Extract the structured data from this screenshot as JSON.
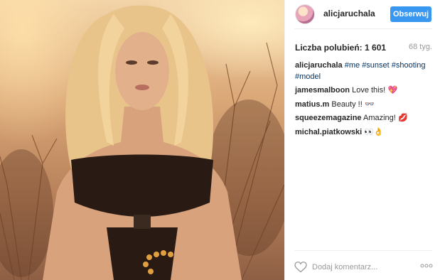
{
  "post": {
    "image_alt": "blonde woman in black cut-out swimsuit at sunset among dry bushes"
  },
  "header": {
    "username": "alicjaruchala",
    "follow_label": "Obserwuj",
    "follow_color": "#3897f0"
  },
  "stats": {
    "likes_label": "Liczba polubień:",
    "likes_count": "1 601",
    "age": "68 tyg."
  },
  "comments": [
    {
      "user": "alicjaruchala",
      "parts": [
        {
          "text": "#me",
          "tag": true
        },
        {
          "text": " ",
          "tag": false
        },
        {
          "text": "#sunset",
          "tag": true
        },
        {
          "text": " ",
          "tag": false
        },
        {
          "text": "#shooting",
          "tag": true
        },
        {
          "text": " ",
          "tag": false
        },
        {
          "text": "#model",
          "tag": true
        }
      ],
      "emoji": ""
    },
    {
      "user": "jamesmalboon",
      "parts": [
        {
          "text": "Love this!",
          "tag": false
        }
      ],
      "emoji": "💖"
    },
    {
      "user": "matius.m",
      "parts": [
        {
          "text": "Beauty !!",
          "tag": false
        }
      ],
      "emoji": "👓"
    },
    {
      "user": "squeezemagazine",
      "parts": [
        {
          "text": "Amazing!",
          "tag": false
        }
      ],
      "emoji": "💋"
    },
    {
      "user": "michal.piatkowski",
      "parts": [],
      "emoji": "👀👌"
    }
  ],
  "footer": {
    "comment_placeholder": "Dodaj komentarz...",
    "like_icon": "heart-icon",
    "more_icon": "more-options-icon"
  }
}
